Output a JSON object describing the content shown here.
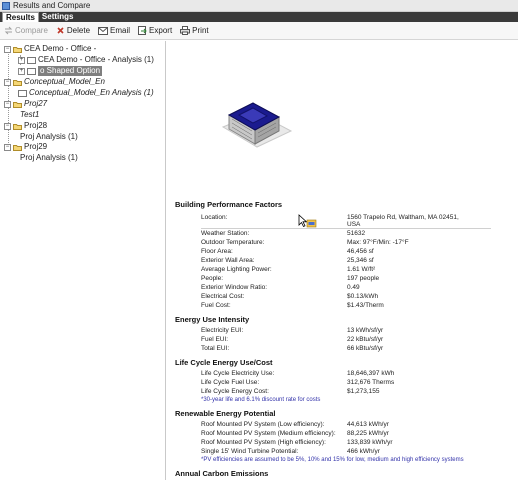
{
  "window": {
    "title": "Results and Compare"
  },
  "tabs": [
    {
      "label": "Results"
    },
    {
      "label": "Settings"
    }
  ],
  "toolbar": {
    "compare": "Compare",
    "delete": "Delete",
    "email": "Email",
    "export": "Export",
    "print": "Print"
  },
  "tree": {
    "items": [
      {
        "label": "CEA Demo - Office -"
      },
      {
        "label": "CEA Demo - Office - Analysis (1)"
      },
      {
        "label": "o Shaped Option"
      },
      {
        "label": "Conceptual_Model_En"
      },
      {
        "label": "Conceptual_Model_En Analysis (1)"
      },
      {
        "label": "Proj27"
      },
      {
        "label": "Test1"
      },
      {
        "label": "Proj28"
      },
      {
        "label": "Proj Analysis (1)"
      },
      {
        "label": "Proj29"
      },
      {
        "label": "Proj Analysis (1)"
      }
    ]
  },
  "report": {
    "bpf": {
      "title": "Building Performance Factors",
      "rows": [
        {
          "label": "Location:",
          "value": "1560 Trapelo Rd, Waltham, MA 02451,"
        },
        {
          "label": "Weather Station:",
          "value": "51632"
        },
        {
          "label": "Outdoor Temperature:",
          "value": "Max: 97°F/Min: -17°F"
        },
        {
          "label": "Floor Area:",
          "value": "46,456 sf"
        },
        {
          "label": "Exterior Wall Area:",
          "value": "25,346 sf"
        },
        {
          "label": "Average Lighting Power:",
          "value": "1.61 W/ft²"
        },
        {
          "label": "People:",
          "value": "197 people"
        },
        {
          "label": "Exterior Window Ratio:",
          "value": "0.49"
        },
        {
          "label": "Electrical Cost:",
          "value": "$0.13/kWh"
        },
        {
          "label": "Fuel Cost:",
          "value": "$1.43/Therm"
        }
      ],
      "location_line2": "USA"
    },
    "eui": {
      "title": "Energy Use Intensity",
      "rows": [
        {
          "label": "Electricity EUI:",
          "value": "13 kWh/sf/yr"
        },
        {
          "label": "Fuel EUI:",
          "value": "22 kBtu/sf/yr"
        },
        {
          "label": "Total EUI:",
          "value": "66 kBtu/sf/yr"
        }
      ]
    },
    "lce": {
      "title": "Life Cycle Energy Use/Cost",
      "rows": [
        {
          "label": "Life Cycle Electricity Use:",
          "value": "18,646,397 kWh"
        },
        {
          "label": "Life Cycle Fuel Use:",
          "value": "312,676 Therms"
        },
        {
          "label": "Life Cycle Energy Cost:",
          "value": "$1,273,155"
        }
      ],
      "note": "*30-year life and 6.1% discount rate for costs"
    },
    "rep": {
      "title": "Renewable Energy Potential",
      "rows": [
        {
          "label": "Roof Mounted PV System (Low efficiency):",
          "value": "44,613 kWh/yr"
        },
        {
          "label": "Roof Mounted PV System (Medium efficiency):",
          "value": "88,225 kWh/yr"
        },
        {
          "label": "Roof Mounted PV System (High efficiency):",
          "value": "133,839 kWh/yr"
        },
        {
          "label": "Single 15' Wind Turbine Potential:",
          "value": "466 kWh/yr"
        }
      ],
      "note": "*PV efficiencies are assumed to be 5%, 10% and 15% for low, medium and high efficiency systems"
    },
    "ace": {
      "title": "Annual Carbon Emissions"
    }
  },
  "colors": {
    "tabbar": "#3a3a3a",
    "selection": "#7f7f7f",
    "note": "#3333aa",
    "building": "#1b1b8f"
  }
}
